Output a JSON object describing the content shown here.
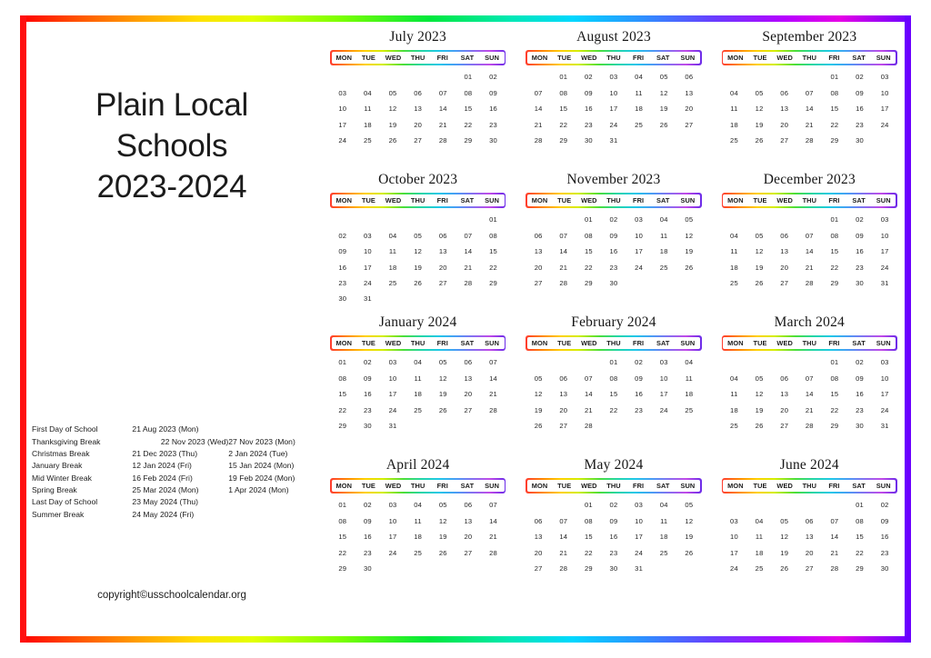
{
  "header": {
    "title_lines": [
      "Plain Local",
      "Schools",
      "2023-2024"
    ]
  },
  "footer": {
    "copyright": "copyright©usschoolcalendar.org"
  },
  "legend": {
    "rows": [
      {
        "label": "First Day of School",
        "start": "21 Aug 2023 (Mon)",
        "end": ""
      },
      {
        "label": "Thanksgiving Break",
        "start": "22 Nov 2023 (Wed)",
        "end": "27 Nov 2023 (Mon)"
      },
      {
        "label": "Christmas Break",
        "start": "21 Dec 2023 (Thu)",
        "end": "2 Jan 2024 (Tue)"
      },
      {
        "label": "January Break",
        "start": "12 Jan 2024 (Fri)",
        "end": "15 Jan 2024 (Mon)"
      },
      {
        "label": "Mid Winter Break",
        "start": "16 Feb 2024 (Fri)",
        "end": "19 Feb 2024 (Mon)"
      },
      {
        "label": "Spring Break",
        "start": "25 Mar 2024 (Mon)",
        "end": "1 Apr 2024 (Mon)"
      },
      {
        "label": "Last Day of School",
        "start": "23 May 2024 (Thu)",
        "end": ""
      },
      {
        "label": "Summer Break",
        "start": "24 May 2024 (Fri)",
        "end": ""
      }
    ]
  },
  "calendar": {
    "weekday_headers": [
      "MON",
      "TUE",
      "WED",
      "THU",
      "FRI",
      "SAT",
      "SUN"
    ],
    "colors": {
      "frame_start": "#ff0000",
      "frame_end": "#6a00ff",
      "frame_left": "#ff1010",
      "frame_right": "#6a00ff",
      "text": "#1b1b1b"
    },
    "months": [
      {
        "name": "July 2023",
        "lead_blanks": 5,
        "days": [
          "01",
          "02",
          "03",
          "04",
          "05",
          "06",
          "07",
          "08",
          "09",
          "10",
          "11",
          "12",
          "13",
          "14",
          "15",
          "16",
          "17",
          "18",
          "19",
          "20",
          "21",
          "22",
          "23",
          "24",
          "25",
          "26",
          "27",
          "28",
          "29",
          "30"
        ]
      },
      {
        "name": "August 2023",
        "lead_blanks": 1,
        "days": [
          "01",
          "02",
          "03",
          "04",
          "05",
          "06",
          "07",
          "08",
          "09",
          "10",
          "11",
          "12",
          "13",
          "14",
          "15",
          "16",
          "17",
          "18",
          "19",
          "20",
          "21",
          "22",
          "23",
          "24",
          "25",
          "26",
          "27",
          "28",
          "29",
          "30",
          "31"
        ]
      },
      {
        "name": "September 2023",
        "lead_blanks": 4,
        "days": [
          "01",
          "02",
          "03",
          "04",
          "05",
          "06",
          "07",
          "08",
          "09",
          "10",
          "11",
          "12",
          "13",
          "14",
          "15",
          "16",
          "17",
          "18",
          "19",
          "20",
          "21",
          "22",
          "23",
          "24",
          "25",
          "26",
          "27",
          "28",
          "29",
          "30"
        ]
      },
      {
        "name": "October 2023",
        "lead_blanks": 6,
        "days": [
          "01",
          "02",
          "03",
          "04",
          "05",
          "06",
          "07",
          "08",
          "09",
          "10",
          "11",
          "12",
          "13",
          "14",
          "15",
          "16",
          "17",
          "18",
          "19",
          "20",
          "21",
          "22",
          "23",
          "24",
          "25",
          "26",
          "27",
          "28",
          "29",
          "30",
          "31"
        ]
      },
      {
        "name": "November 2023",
        "lead_blanks": 2,
        "days": [
          "01",
          "02",
          "03",
          "04",
          "05",
          "06",
          "07",
          "08",
          "09",
          "10",
          "11",
          "12",
          "13",
          "14",
          "15",
          "16",
          "17",
          "18",
          "19",
          "20",
          "21",
          "22",
          "23",
          "24",
          "25",
          "26",
          "27",
          "28",
          "29",
          "30"
        ]
      },
      {
        "name": "December 2023",
        "lead_blanks": 4,
        "days": [
          "01",
          "02",
          "03",
          "04",
          "05",
          "06",
          "07",
          "08",
          "09",
          "10",
          "11",
          "12",
          "13",
          "14",
          "15",
          "16",
          "17",
          "18",
          "19",
          "20",
          "21",
          "22",
          "23",
          "24",
          "25",
          "26",
          "27",
          "28",
          "29",
          "30",
          "31"
        ]
      },
      {
        "name": "January 2024",
        "lead_blanks": 0,
        "days": [
          "01",
          "02",
          "03",
          "04",
          "05",
          "06",
          "07",
          "08",
          "09",
          "10",
          "11",
          "12",
          "13",
          "14",
          "15",
          "16",
          "17",
          "18",
          "19",
          "20",
          "21",
          "22",
          "23",
          "24",
          "25",
          "26",
          "27",
          "28",
          "29",
          "30",
          "31"
        ]
      },
      {
        "name": "February 2024",
        "lead_blanks": 3,
        "days": [
          "01",
          "02",
          "03",
          "04",
          "05",
          "06",
          "07",
          "08",
          "09",
          "10",
          "11",
          "12",
          "13",
          "14",
          "15",
          "16",
          "17",
          "18",
          "19",
          "20",
          "21",
          "22",
          "23",
          "24",
          "25",
          "26",
          "27",
          "28"
        ]
      },
      {
        "name": "March 2024",
        "lead_blanks": 4,
        "days": [
          "01",
          "02",
          "03",
          "04",
          "05",
          "06",
          "07",
          "08",
          "09",
          "10",
          "11",
          "12",
          "13",
          "14",
          "15",
          "16",
          "17",
          "18",
          "19",
          "20",
          "21",
          "22",
          "23",
          "24",
          "25",
          "26",
          "27",
          "28",
          "29",
          "30",
          "31"
        ]
      },
      {
        "name": "April 2024",
        "lead_blanks": 0,
        "days": [
          "01",
          "02",
          "03",
          "04",
          "05",
          "06",
          "07",
          "08",
          "09",
          "10",
          "11",
          "12",
          "13",
          "14",
          "15",
          "16",
          "17",
          "18",
          "19",
          "20",
          "21",
          "22",
          "23",
          "24",
          "25",
          "26",
          "27",
          "28",
          "29",
          "30"
        ]
      },
      {
        "name": "May 2024",
        "lead_blanks": 2,
        "days": [
          "01",
          "02",
          "03",
          "04",
          "05",
          "06",
          "07",
          "08",
          "09",
          "10",
          "11",
          "12",
          "13",
          "14",
          "15",
          "16",
          "17",
          "18",
          "19",
          "20",
          "21",
          "22",
          "23",
          "24",
          "25",
          "26",
          "27",
          "28",
          "29",
          "30",
          "31"
        ]
      },
      {
        "name": "June 2024",
        "lead_blanks": 5,
        "days": [
          "01",
          "02",
          "03",
          "04",
          "05",
          "06",
          "07",
          "08",
          "09",
          "10",
          "11",
          "12",
          "13",
          "14",
          "15",
          "16",
          "17",
          "18",
          "19",
          "20",
          "21",
          "22",
          "23",
          "24",
          "25",
          "26",
          "27",
          "28",
          "29",
          "30"
        ]
      }
    ]
  }
}
